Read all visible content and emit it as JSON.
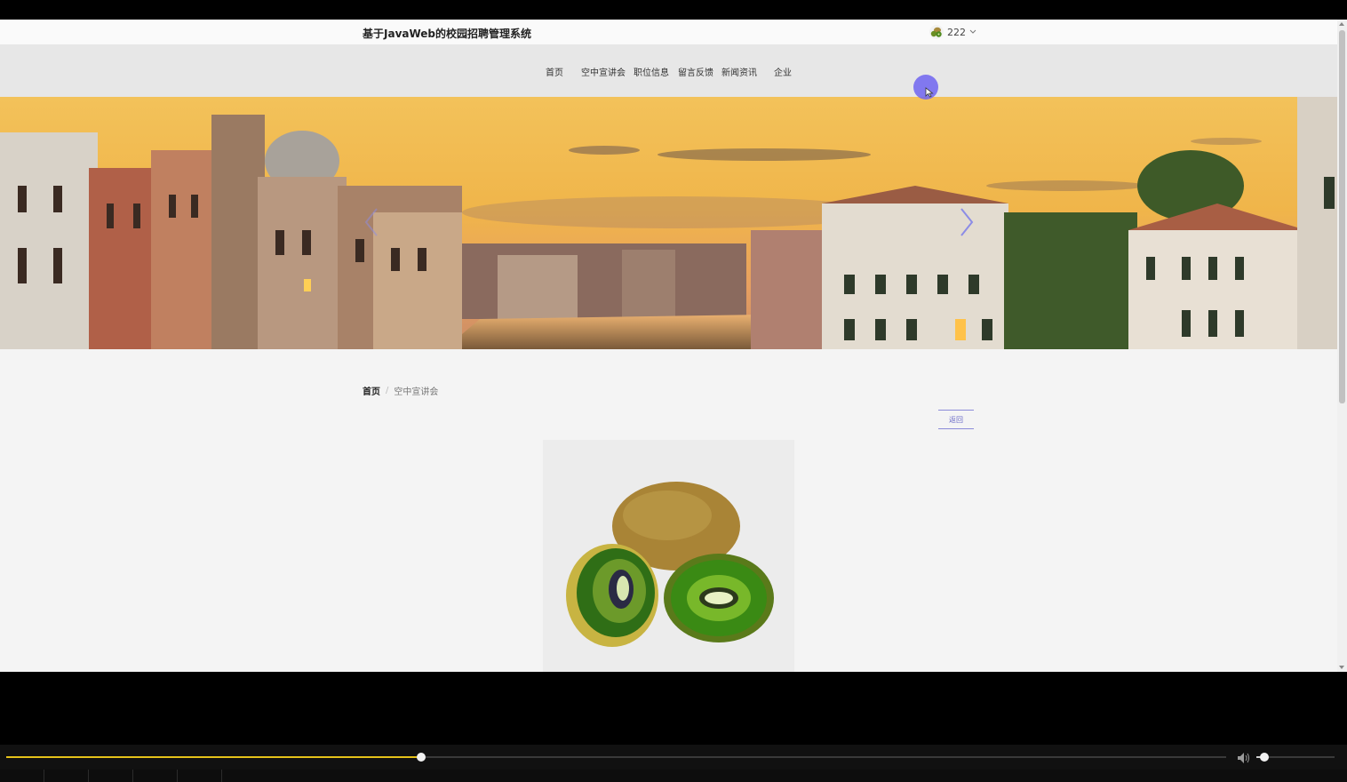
{
  "header": {
    "site_title": "基于JavaWeb的校园招聘管理系统",
    "username": "222",
    "avatar_icon": "kiwi-avatar-icon",
    "dropdown_icon": "chevron-down-icon"
  },
  "nav": {
    "items": [
      {
        "label": "首页"
      },
      {
        "label": "空中宣讲会"
      },
      {
        "label": "职位信息"
      },
      {
        "label": "留言反馈"
      },
      {
        "label": "新闻资讯"
      },
      {
        "label": "企业"
      }
    ]
  },
  "banner": {
    "prev_icon": "chevron-left-icon",
    "next_icon": "chevron-right-icon"
  },
  "breadcrumb": {
    "home": "首页",
    "separator": "/",
    "current": "空中宣讲会"
  },
  "actions": {
    "back_label": "返回"
  },
  "player": {
    "progress_fraction": 0.34,
    "volume_fraction": 0.1,
    "progress_color": "#e6c21a",
    "volume_icon": "speaker-icon"
  },
  "colors": {
    "accent": "#6b6bc8",
    "cursor_highlight": "#6e64f0"
  }
}
